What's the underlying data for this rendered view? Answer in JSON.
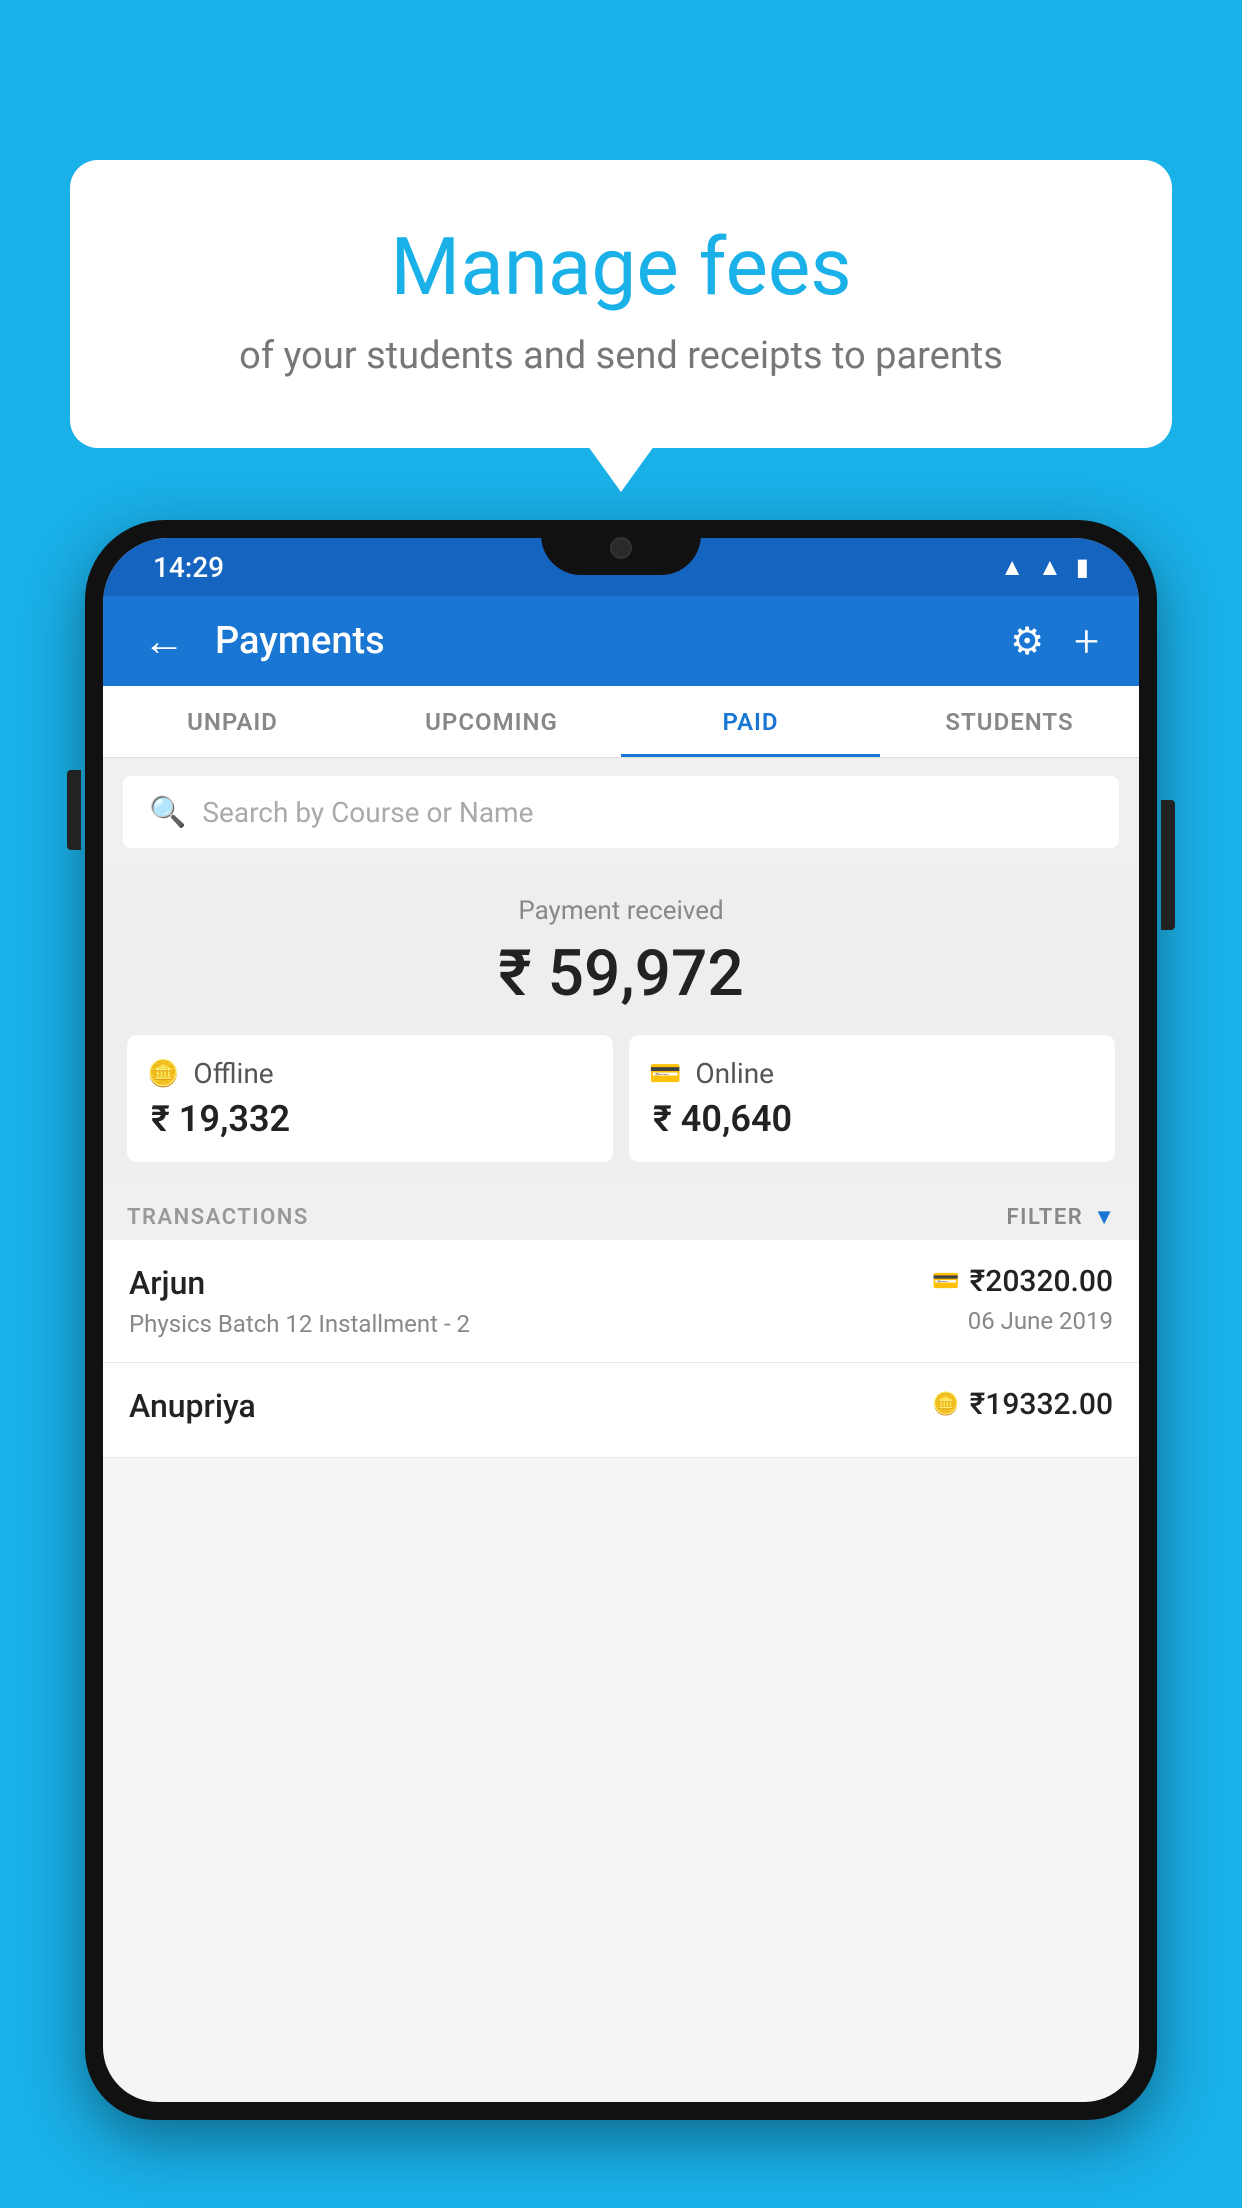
{
  "background": {
    "color": "#1ab0e8"
  },
  "speech_bubble": {
    "title": "Manage fees",
    "subtitle": "of your students and send receipts to parents"
  },
  "status_bar": {
    "time": "14:29",
    "wifi_icon": "▲",
    "signal_icon": "▲",
    "battery_icon": "▮"
  },
  "app_header": {
    "title": "Payments",
    "back_label": "←",
    "gear_label": "⚙",
    "plus_label": "+"
  },
  "tabs": [
    {
      "id": "unpaid",
      "label": "UNPAID",
      "active": false
    },
    {
      "id": "upcoming",
      "label": "UPCOMING",
      "active": false
    },
    {
      "id": "paid",
      "label": "PAID",
      "active": true
    },
    {
      "id": "students",
      "label": "STUDENTS",
      "active": false
    }
  ],
  "search": {
    "placeholder": "Search by Course or Name"
  },
  "payment_summary": {
    "label": "Payment received",
    "amount": "₹ 59,972",
    "offline_label": "Offline",
    "offline_amount": "₹ 19,332",
    "online_label": "Online",
    "online_amount": "₹ 40,640"
  },
  "transactions_section": {
    "label": "TRANSACTIONS",
    "filter_label": "FILTER"
  },
  "transactions": [
    {
      "name": "Arjun",
      "course": "Physics Batch 12 Installment - 2",
      "amount": "₹20320.00",
      "date": "06 June 2019",
      "payment_type": "online"
    },
    {
      "name": "Anupriya",
      "course": "",
      "amount": "₹19332.00",
      "date": "",
      "payment_type": "offline"
    }
  ]
}
